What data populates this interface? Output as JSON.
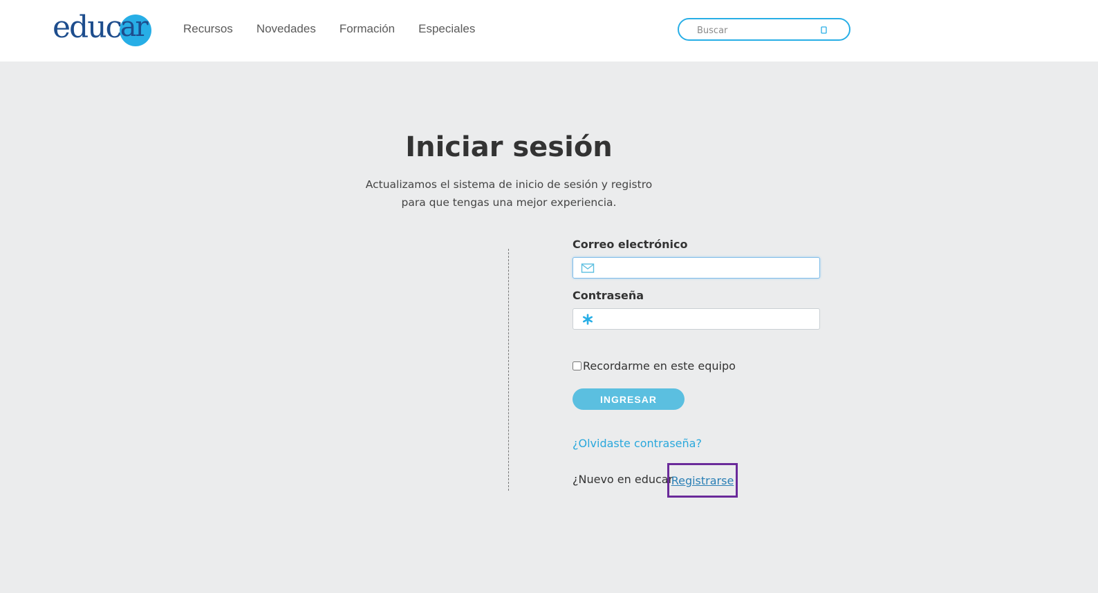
{
  "header": {
    "logo": {
      "text_main": "educ",
      "text_circle": "ar"
    },
    "nav": [
      {
        "label": "Recursos"
      },
      {
        "label": "Novedades"
      },
      {
        "label": "Formación"
      },
      {
        "label": "Especiales"
      }
    ],
    "search": {
      "placeholder": "Buscar",
      "icon": "search-icon"
    }
  },
  "login": {
    "title": "Iniciar sesión",
    "subtitle_line1": "Actualizamos el sistema de inicio de sesión y registro",
    "subtitle_line2": "para que tengas una mejor experiencia.",
    "email_label": "Correo electrónico",
    "email_value": "",
    "email_icon": "envelope-icon",
    "password_label": "Contraseña",
    "password_value": "",
    "password_icon": "asterisk-icon",
    "remember_label": "Recordarme en este equipo",
    "remember_checked": false,
    "submit_label": "INGRESAR",
    "forgot_label": "¿Olvidaste contraseña?",
    "new_user_text": "¿Nuevo en educar",
    "register_label": "Registrarse"
  },
  "colors": {
    "accent": "#27aee6",
    "logo_dark": "#1d4d8d",
    "button": "#5bbfe0",
    "page_bg": "#ebeced",
    "highlight_box": "#6a2a9a"
  }
}
